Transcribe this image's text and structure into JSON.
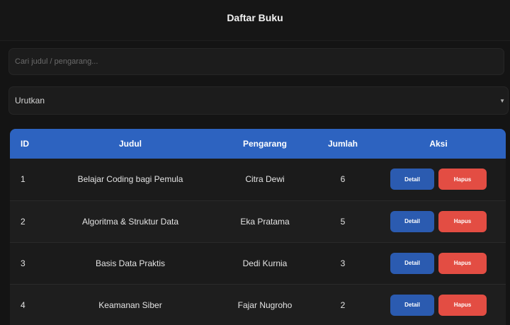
{
  "header": {
    "title": "Daftar Buku"
  },
  "search": {
    "placeholder": "Cari judul / pengarang..."
  },
  "sort": {
    "label": "Urutkan"
  },
  "table": {
    "columns": [
      "ID",
      "Judul",
      "Pengarang",
      "Jumlah",
      "Aksi"
    ],
    "detail_label": "Detail",
    "hapus_label": "Hapus",
    "rows": [
      {
        "id": "1",
        "judul": "Belajar Coding bagi Pemula",
        "pengarang": "Citra Dewi",
        "jumlah": "6"
      },
      {
        "id": "2",
        "judul": "Algoritma & Struktur Data",
        "pengarang": "Eka Pratama",
        "jumlah": "5"
      },
      {
        "id": "3",
        "judul": "Basis Data Praktis",
        "pengarang": "Dedi Kurnia",
        "jumlah": "3"
      },
      {
        "id": "4",
        "judul": "Keamanan Siber",
        "pengarang": "Fajar Nugroho",
        "jumlah": "2"
      }
    ]
  },
  "colors": {
    "header_blue": "#2d63c0",
    "detail_button": "#2b5bb0",
    "hapus_button": "#e34d43",
    "background": "#141414"
  },
  "icons": {
    "sort_dropdown": "chevron-down-icon"
  }
}
